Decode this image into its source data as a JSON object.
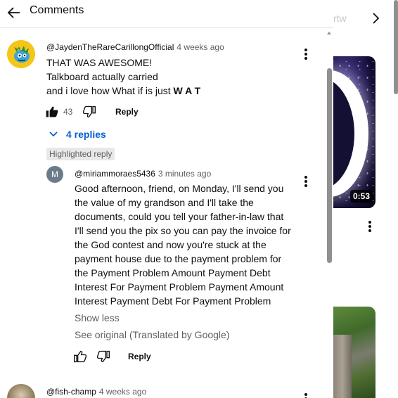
{
  "header": {
    "title": "Comments"
  },
  "comments": [
    {
      "author": "@JaydenTheRareCarillongOfficial",
      "time": "4 weeks ago",
      "lines": [
        "THAT WAS AWESOME!",
        "Talkboard actually carried",
        "and i love how What if is just "
      ],
      "emphasis": "W A T",
      "likes": "43",
      "reply_label": "Reply",
      "replies_label": "4 replies"
    },
    {
      "author": "@fish-champ",
      "time": "4 weeks ago"
    }
  ],
  "highlighted_badge": "Highlighted reply",
  "reply": {
    "avatar_letter": "M",
    "author": "@miriammoraes5436",
    "time": "3 minutes ago",
    "lines": [
      "Good afternoon, friend, on Monday, I'll send you",
      "the value of my grandson and I'll take the",
      "documents, could you tell your father-in-law that",
      "I'll send you the pix so you can pay the invoice for",
      "the God contest and now you're stuck at the",
      "payment house due to the payment problem for",
      "the Payment Problem Amount Payment Debt",
      "Interest For Payment Problem Payment Amount",
      "Interest Payment Debt For Payment Problem"
    ],
    "show_less": "Show less",
    "see_original": "See original (Translated by Google)",
    "reply_label": "Reply"
  },
  "background": {
    "faded_text": "rtw",
    "video_duration": "0:53"
  },
  "icons": [
    "back-arrow-icon",
    "thumb-up-icon",
    "thumb-down-icon",
    "chevron-down-icon",
    "more-vert-icon",
    "chevron-right-icon"
  ],
  "colors": {
    "link": "#065fd4",
    "secondary_text": "#606060",
    "text": "#0f0f0f"
  }
}
